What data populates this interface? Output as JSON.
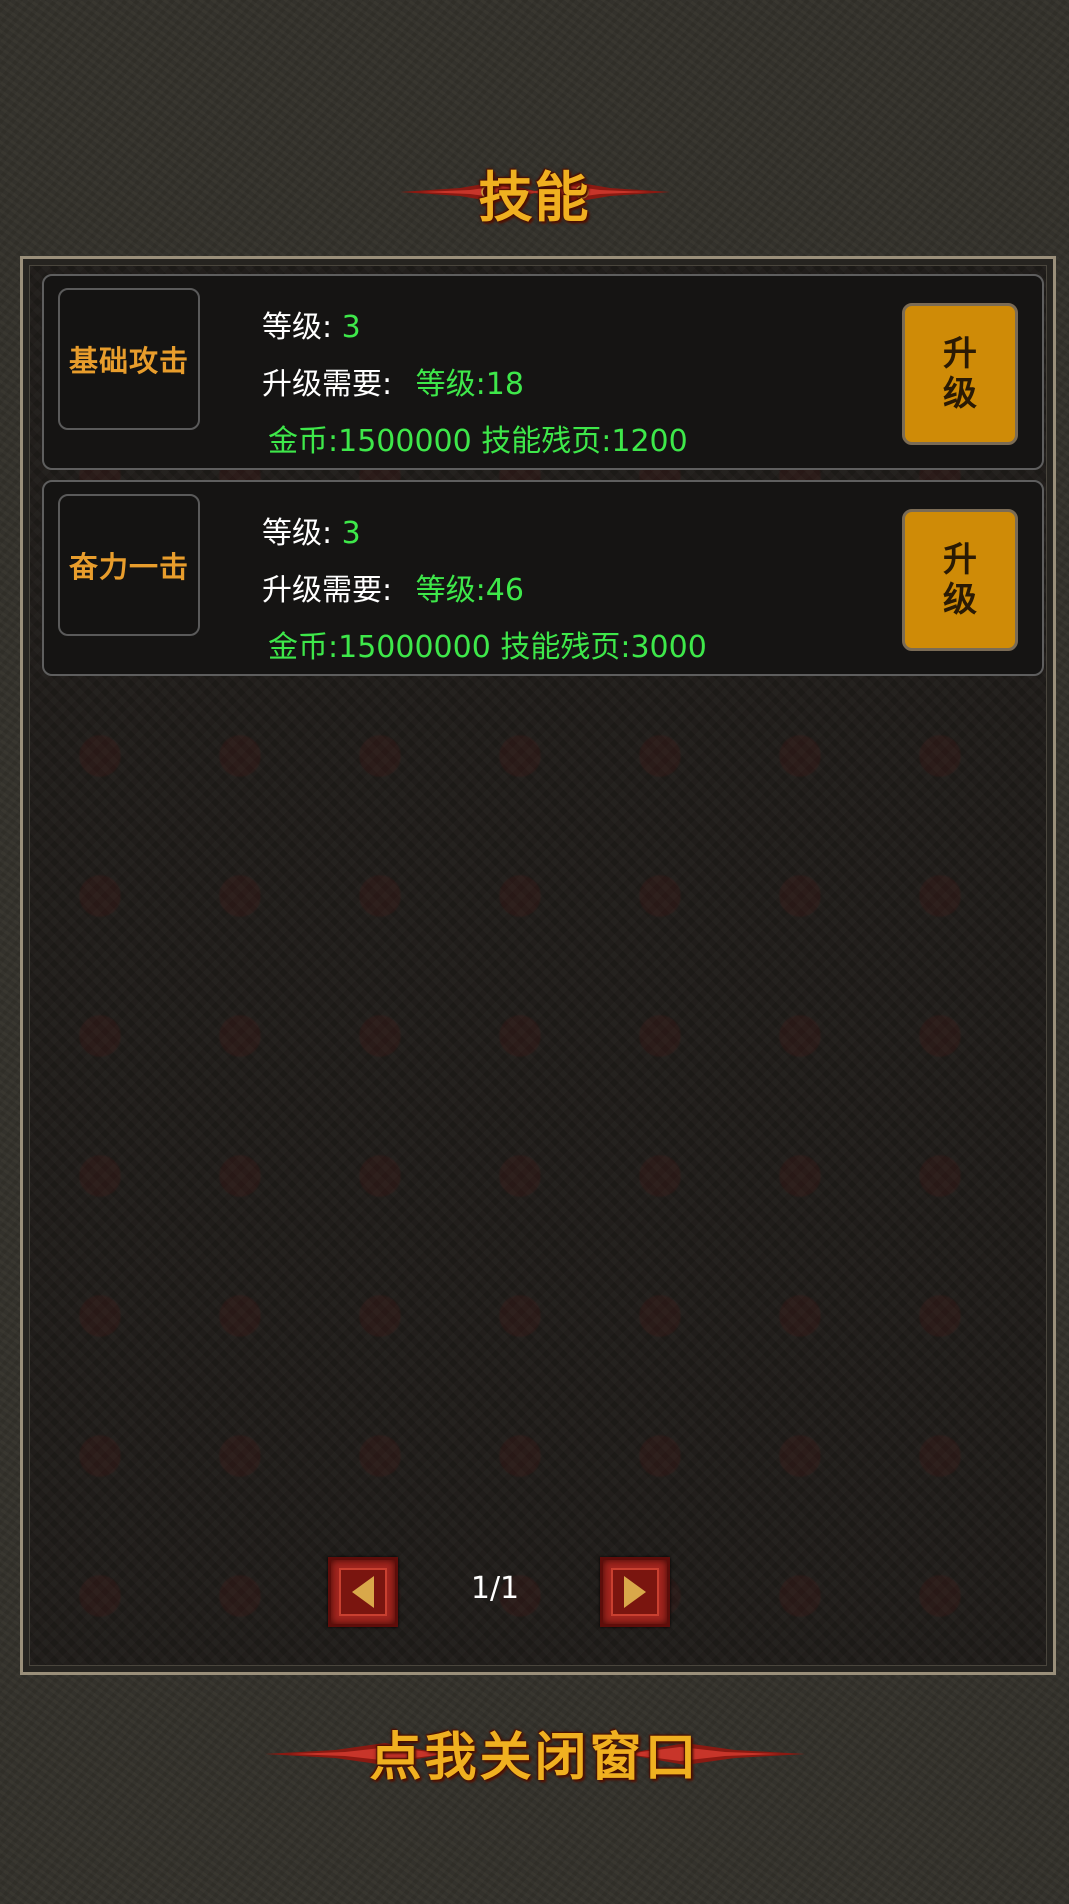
{
  "window": {
    "title": "技能",
    "close_label": "点我关闭窗口"
  },
  "labels": {
    "level": "等级:",
    "requirement": "升级需要:",
    "upgrade_top": "升",
    "upgrade_bottom": "级"
  },
  "skills": [
    {
      "name": "基础攻击",
      "level": "3",
      "required_level": "等级:18",
      "cost": "金币:1500000 技能残页:1200"
    },
    {
      "name": "奋力一击",
      "level": "3",
      "required_level": "等级:46",
      "cost": "金币:15000000 技能残页:3000"
    }
  ],
  "pager": {
    "page": "1/1"
  },
  "colors": {
    "gold_title": "#f0b020",
    "skill_name": "#e89d2c",
    "green_value": "#3ee84a",
    "upgrade_button": "#cf8b07",
    "arrow_button": "#a3261f"
  },
  "icons": {
    "prev": "triangle-left-icon",
    "next": "triangle-right-icon",
    "banner_ornament": "red-flourish-ornament"
  }
}
